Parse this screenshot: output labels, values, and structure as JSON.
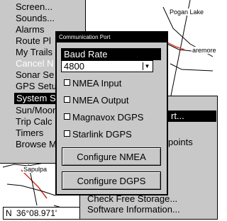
{
  "map": {
    "labels": [
      "Sapulpa",
      "Pogan Lake",
      "aremore"
    ],
    "status": {
      "prefix": "N",
      "coord": "36°08.971'"
    }
  },
  "main_menu": {
    "items": [
      {
        "label": "Screen...",
        "state": "normal"
      },
      {
        "label": "Sounds...",
        "state": "normal"
      },
      {
        "label": "Alarms",
        "state": "normal"
      },
      {
        "label": "Route Pl",
        "state": "normal"
      },
      {
        "label": "My Trails",
        "state": "normal"
      },
      {
        "label": "Cancel N",
        "state": "disabled"
      },
      {
        "label": "Sonar Se",
        "state": "normal"
      },
      {
        "label": "GPS Setu",
        "state": "normal"
      },
      {
        "label": "System S",
        "state": "selected"
      },
      {
        "label": "Sun/Moon",
        "state": "normal"
      },
      {
        "label": "Trip Calc",
        "state": "normal"
      },
      {
        "label": "Timers",
        "state": "normal"
      },
      {
        "label": "Browse M",
        "state": "normal"
      }
    ]
  },
  "sub_menu": {
    "items": [
      {
        "label": "rt...",
        "state": "selected"
      },
      {
        "label": "points",
        "state": "normal"
      },
      {
        "label": "Check Free Storage...",
        "state": "normal"
      },
      {
        "label": "Software Information...",
        "state": "normal"
      }
    ]
  },
  "dialog": {
    "title": "Communication Port",
    "baud_label": "Baud Rate",
    "baud_value": "4800",
    "checkboxes": [
      {
        "label": "NMEA Input",
        "checked": false
      },
      {
        "label": "NMEA Output",
        "checked": false
      },
      {
        "label": "Magnavox DGPS",
        "checked": false
      },
      {
        "label": "Starlink DGPS",
        "checked": false
      }
    ],
    "buttons": {
      "configure_nmea": "Configure NMEA",
      "configure_dgps": "Configure DGPS"
    }
  },
  "colors": {
    "panel": "#c8c8c8",
    "selection": "#000000",
    "selection_text": "#ffffff",
    "map_background": "#ffffff"
  }
}
